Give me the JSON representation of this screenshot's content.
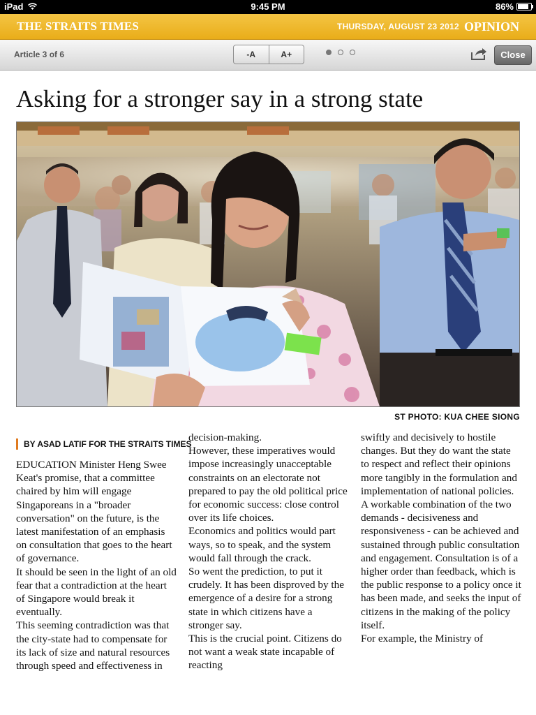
{
  "status_bar": {
    "device": "iPad",
    "time": "9:45 PM",
    "battery": "86%",
    "battery_level": 0.86
  },
  "masthead": {
    "brand": "THE STRAITS TIMES",
    "date": "THURSDAY, AUGUST 23 2012",
    "section": "OPINION"
  },
  "toolbar": {
    "article_counter": "Article 3 of 6",
    "font_smaller": "-A",
    "font_larger": "A+",
    "page_dots": 3,
    "active_page": 0,
    "close_label": "Close",
    "share_icon": "share-icon"
  },
  "article": {
    "headline": "Asking for a stronger say in a strong state",
    "photo_credit": "ST PHOTO: KUA CHEE SIONG",
    "byline": "BY ASAD LATIF FOR THE STRAITS TIMES",
    "columns": [
      "EDUCATION Minister Heng Swee Keat's promise, that a committee chaired by him will engage Singaporeans in a \"broader conversation\" on the future, is the latest manifestation of an emphasis on consultation that goes to the heart of governance.\n It should be seen in the light of an old fear that a contradiction at the heart of Singapore would break it eventually.\n This seeming contradiction was that the city-state had to compensate for its lack of size and natural resources through speed and effectiveness in",
      "decision-making.\n However, these imperatives would impose increasingly unacceptable constraints on an electorate not prepared to pay the old political price for economic success: close control over its life choices.\n Economics and politics would part ways, so to speak, and the system would fall through the crack.\n So went the prediction, to put it crudely. It has been disproved by the emergence of a desire for a strong state in which citizens have a stronger say.\n This is the crucial point. Citizens do not want a weak state incapable of reacting",
      "swiftly and decisively to hostile changes. But they do want the state to respect and reflect their opinions more tangibly in the formulation and implementation of national policies.\n A workable combination of the two demands - decisiveness and responsiveness - can be achieved and sustained through public consultation and engagement. Consultation is of a higher order than feedback, which is the public response to a policy once it has been made, and seeks the input of citizens in the making of the policy itself.\n For example, the Ministry of"
    ]
  },
  "colors": {
    "masthead": "#f0b929",
    "byline_accent": "#e07a1f"
  }
}
